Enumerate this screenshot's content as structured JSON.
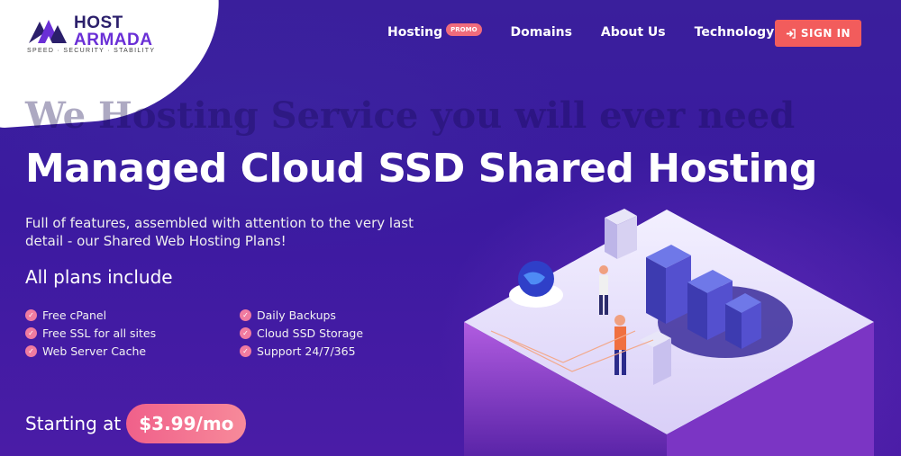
{
  "logo": {
    "line1": "HOST",
    "line2": "ARMADA",
    "tagline": "SPEED · SECURITY · STABILITY"
  },
  "nav": {
    "items": [
      {
        "label": "Hosting",
        "badge": "PROMO"
      },
      {
        "label": "Domains"
      },
      {
        "label": "About Us"
      },
      {
        "label": "Technology"
      }
    ],
    "signin": "SIGN IN"
  },
  "hero": {
    "ghost_text": "We Hosting Service you will ever need",
    "title": "Managed Cloud SSD Shared Hosting",
    "subtitle": "Full of features, assembled with attention to the very last detail - our Shared Web Hosting Plans!",
    "plans_title": "All plans include",
    "features": [
      "Free cPanel",
      "Daily Backups",
      "Free SSL for all sites",
      "Cloud SSD Storage",
      "Web Server Cache",
      "Support 24/7/365"
    ],
    "starting_label": "Starting at",
    "price": "$3.99/mo"
  },
  "colors": {
    "accent": "#f25c5c",
    "check": "#f07ba0",
    "brand_purple": "#6a2fd6"
  }
}
